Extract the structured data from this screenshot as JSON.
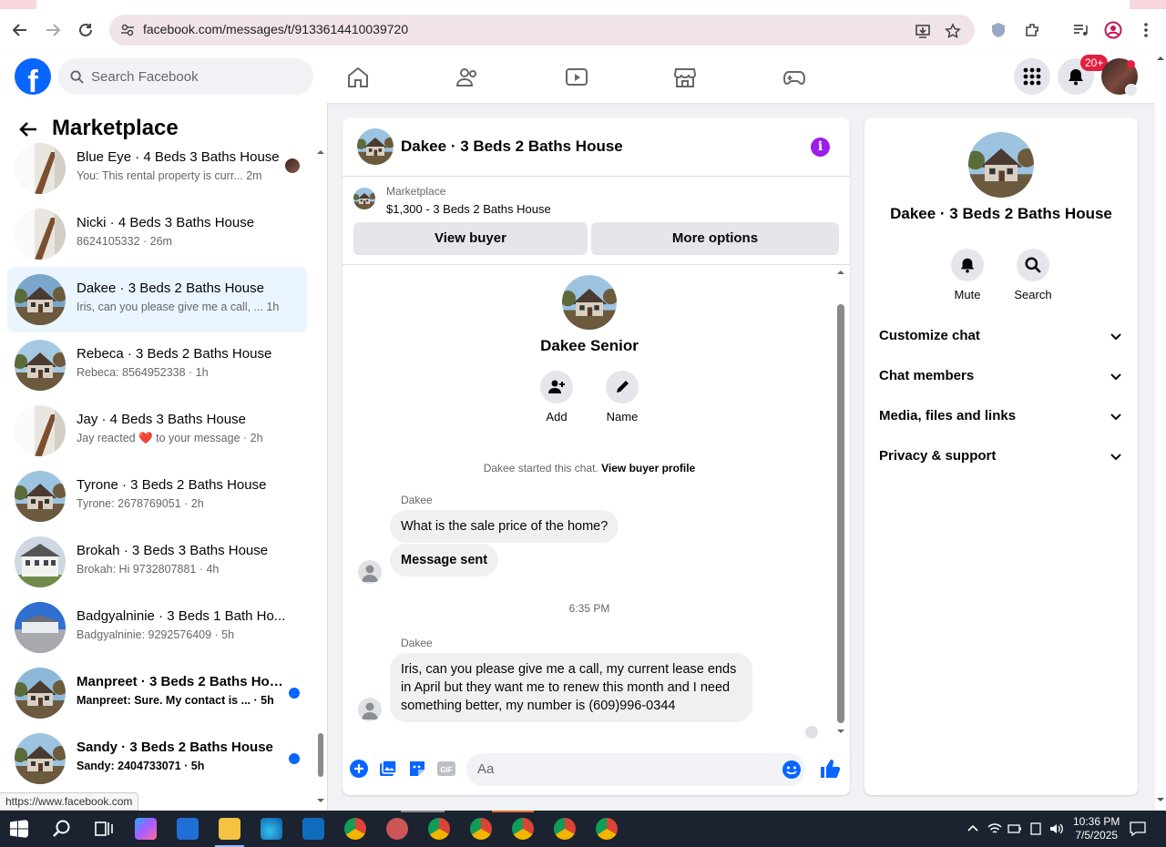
{
  "browser": {
    "url": "facebook.com/messages/t/9133614410039720",
    "status_url": "https://www.facebook.com"
  },
  "fb": {
    "search_placeholder": "Search Facebook",
    "notif_count": "20+"
  },
  "left": {
    "title": "Marketplace",
    "conversations": [
      {
        "name": "Blue Eye · 4 Beds 3 Baths House",
        "sub": "You: This rental property is curr... 2m",
        "unread": false,
        "seen": true
      },
      {
        "name": "Nicki · 4 Beds 3 Baths House",
        "sub": "8624105332 · 26m",
        "unread": false,
        "seen": false
      },
      {
        "name": "Dakee · 3 Beds 2 Baths House",
        "sub": "Iris, can you please give me a call, ... 1h",
        "unread": false,
        "seen": false,
        "active": true
      },
      {
        "name": "Rebeca · 3 Beds 2 Baths House",
        "sub": "Rebeca: 8564952338 · 1h",
        "unread": false,
        "seen": false
      },
      {
        "name": "Jay · 4 Beds 3 Baths House",
        "sub": "Jay reacted ❤️ to your message · 2h",
        "unread": false,
        "seen": false
      },
      {
        "name": "Tyrone · 3 Beds 2 Baths House",
        "sub": "Tyrone: 2678769051 · 2h",
        "unread": false,
        "seen": false
      },
      {
        "name": "Brokah · 3 Beds 3 Baths House",
        "sub": "Brokah: Hi 9732807881 · 4h",
        "unread": false,
        "seen": false
      },
      {
        "name": "Badgyalninie · 3 Beds 1 Bath Ho...",
        "sub": "Badgyalninie: 9292576409 · 5h",
        "unread": false,
        "seen": false
      },
      {
        "name": "Manpreet · 3 Beds 2 Baths Hou...",
        "sub": "Manpreet: Sure. My contact is ... · 5h",
        "unread": true,
        "seen": false
      },
      {
        "name": "Sandy · 3 Beds 2 Baths House",
        "sub": "Sandy: 2404733071 · 5h",
        "unread": true,
        "seen": false
      }
    ]
  },
  "chat": {
    "title": "Dakee · 3 Beds 2 Baths House",
    "listing_label": "Marketplace",
    "listing_price": "$1,300 - 3 Beds 2 Baths House",
    "view_buyer": "View buyer",
    "more_options": "More options",
    "contact_name": "Dakee Senior",
    "add_label": "Add",
    "name_label": "Name",
    "system_text": "Dakee started this chat.",
    "system_link": "View buyer profile",
    "sender1": "Dakee",
    "msg1": "What is the sale price of the home?",
    "msg2": "Message sent",
    "timestamp": "6:35 PM",
    "sender2": "Dakee",
    "msg3": "Iris, can you please give me a call, my current lease ends in April but they want me to renew this month and I need something better, my number is (609)996-0344",
    "composer_placeholder": "Aa"
  },
  "right": {
    "title": "Dakee · 3 Beds 2 Baths House",
    "mute": "Mute",
    "search": "Search",
    "sections": [
      "Customize chat",
      "Chat members",
      "Media, files and links",
      "Privacy & support"
    ]
  },
  "taskbar": {
    "time": "10:36 PM",
    "date": "7/5/2025"
  },
  "colors": {
    "fb_blue": "#0866ff",
    "active_conv": "#ebf5ff",
    "info_purple": "#9b1fe9",
    "notif_red": "#e41e3f"
  }
}
